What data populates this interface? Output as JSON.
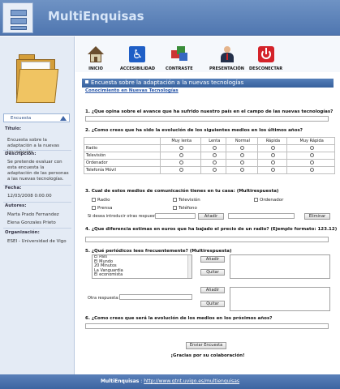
{
  "app": {
    "title": "MultiEnquisas"
  },
  "toolbar": [
    {
      "label": "INICIO",
      "icon": "home-icon"
    },
    {
      "label": "ACCESIBILIDAD",
      "icon": "accessibility-icon"
    },
    {
      "label": "CONTRASTE",
      "icon": "contrast-icon"
    },
    {
      "label": "PRESENTACIÓN",
      "icon": "presenter-icon"
    },
    {
      "label": "DESCONECTAR",
      "icon": "power-icon"
    }
  ],
  "sidebar": {
    "tab_label": "Encuesta",
    "titulo_label": "Título:",
    "titulo_value": "Encuesta sobre la adaptación a la nuevas tecnologías",
    "descripcion_label": "Descripción:",
    "descripcion_value": "Se pretende evaluar con esta encuesta la adaptación de las personas a las nuevas tecnologías.",
    "fecha_label": "Fecha:",
    "fecha_value": "12/03/2008 0:00:00",
    "autores_label": "Autores:",
    "autores": [
      "Marta Prado Fernandez",
      "Elena Gonzales Prieto"
    ],
    "organizacion_label": "Organización:",
    "organizacion_value": "ESEI - Universidad de Vigo"
  },
  "survey": {
    "title": "Encuesta sobre la adaptación a la nuevas tecnologías",
    "section": "Conocimiento en Nuevas Tecnologías",
    "q1": "1. ¿Que opina sobre el avance que ha sufrido nuestro país en el campo de las nuevas tecnologías?",
    "q2": "2. ¿Como crees que ha sido la evolución de los siguientes medios en los últimos años?",
    "q2_columns": [
      "Muy lenta",
      "Lenta",
      "Normal",
      "Rápida",
      "Muy Rápida"
    ],
    "q2_rows": [
      "Radio",
      "Televisión",
      "Ordenador",
      "Telefonía Móvil"
    ],
    "q3": "3. Cual de estos medios de comunicación tienes en tu casa: (Multirespuesta)",
    "q3_options": [
      "Radio",
      "Televisión",
      "Ordenador",
      "Prensa",
      "Teléfono"
    ],
    "q3_other_label": "Si desea introducir otras respuestas:",
    "add_label": "Añadir",
    "remove_label": "Eliminar",
    "q4": "4. ¿Que diferencia estimas en euros que ha bajado el precio de un radio? (Ejemplo formato: 123.12)",
    "q5": "5. ¿Qué periódicos lees frecuentemente? (Multirespuesta)",
    "q5_options": [
      "El País",
      "El Mundo",
      "20 Minutos",
      "La Vanguardia",
      "El economista"
    ],
    "q5_add_label": "Añadir",
    "q5_remove_label": "Quitar",
    "q5_other_label": "Otra respuesta:",
    "q6": "6. ¿Como crees que será la evolución de los medios en los próximos años?",
    "submit_label": "Enviar Encuesta",
    "thanks": "¡Gracias por su colaboración!"
  },
  "footer": {
    "name": "MultiEnquisas",
    "separator": " : ",
    "url": "http://www.gtnt.uvigo.es/multienquisas"
  }
}
